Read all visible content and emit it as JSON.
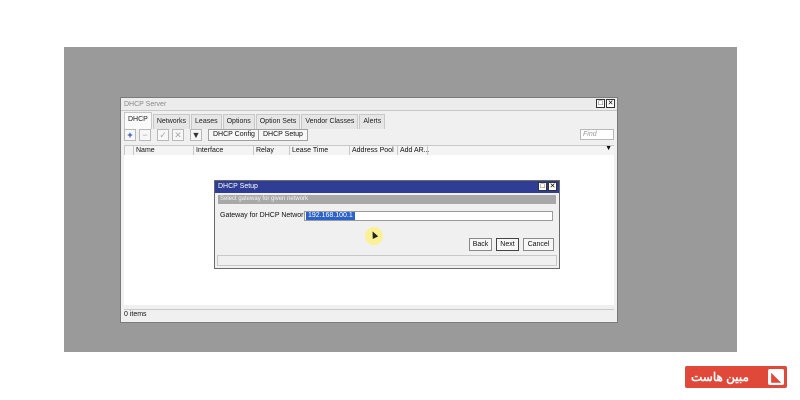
{
  "window": {
    "title": "DHCP Server",
    "tabs": [
      "DHCP",
      "Networks",
      "Leases",
      "Options",
      "Option Sets",
      "Vendor Classes",
      "Alerts"
    ],
    "toolbar": {
      "add_icon": "+",
      "remove_icon": "−",
      "check_icon": "✓",
      "cross_icon": "✕",
      "filter_icon": "▼",
      "dhcp_config_label": "DHCP Config",
      "dhcp_setup_label": "DHCP Setup",
      "find_placeholder": "Find"
    },
    "columns": [
      "Name",
      "Interface",
      "Relay",
      "Lease Time",
      "Address Pool",
      "Add AR..."
    ],
    "status": "0 items"
  },
  "dialog": {
    "title": "DHCP Setup",
    "hint": "Select gateway for given network",
    "gateway_label": "Gateway for DHCP Network:",
    "gateway_value": "192.168.100.1",
    "back_label": "Back",
    "next_label": "Next",
    "cancel_label": "Cancel"
  },
  "brand": {
    "text": "مبین هاست",
    "accent": "#e0493a"
  }
}
